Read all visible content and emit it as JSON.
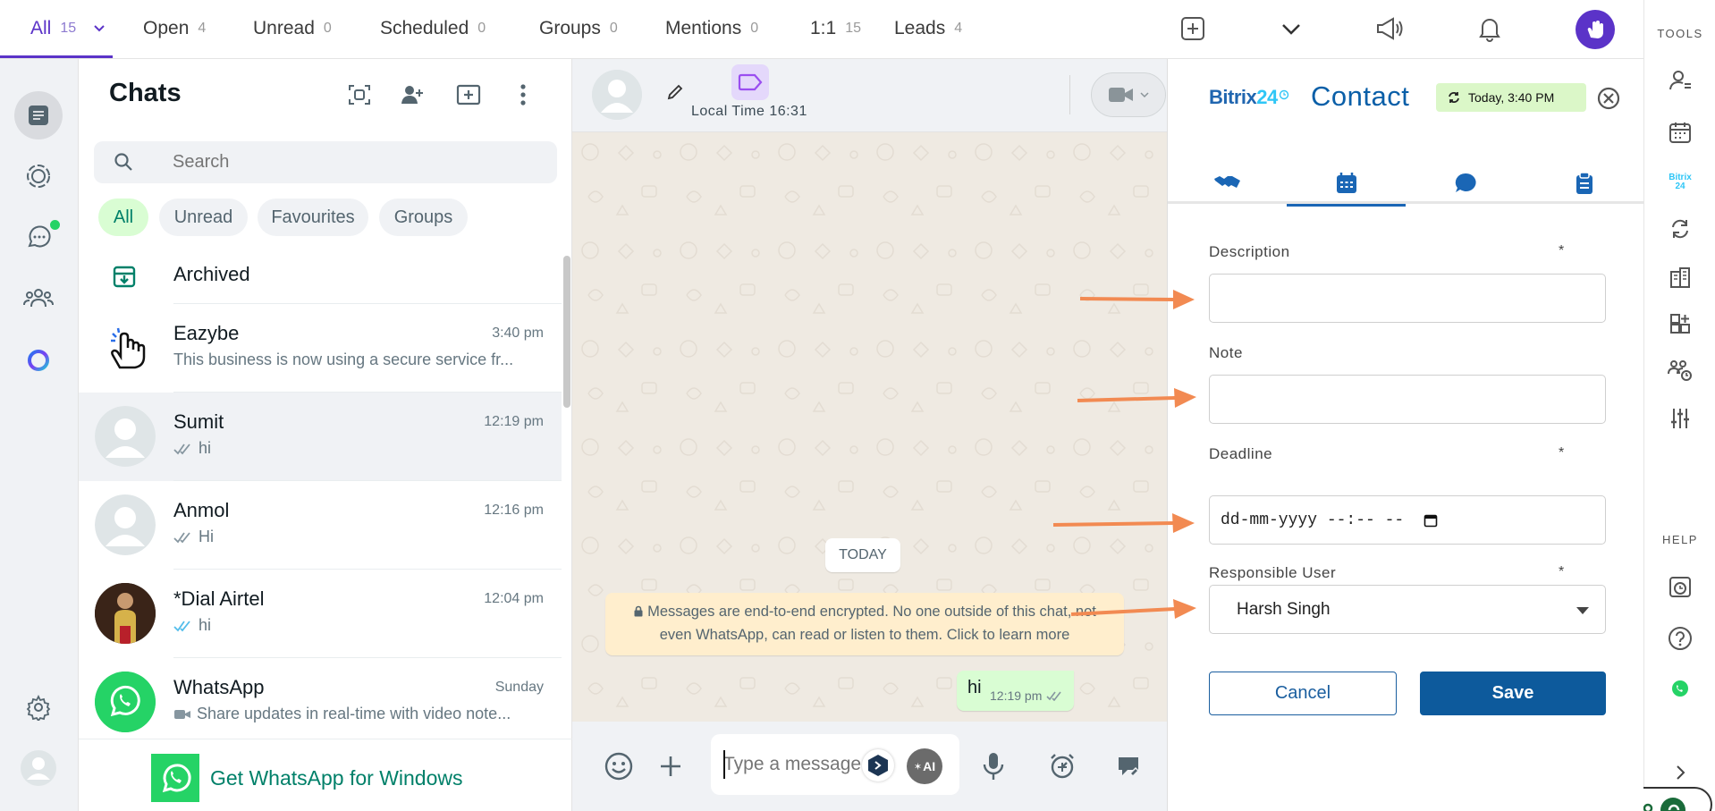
{
  "topbar": {
    "tabs": [
      {
        "label": "All",
        "count": "15"
      },
      {
        "label": "Open",
        "count": "4"
      },
      {
        "label": "Unread",
        "count": "0"
      },
      {
        "label": "Scheduled",
        "count": "0"
      },
      {
        "label": "Groups",
        "count": "0"
      },
      {
        "label": "Mentions",
        "count": "0"
      },
      {
        "label": "1:1",
        "count": "15"
      },
      {
        "label": "Leads",
        "count": "4"
      }
    ],
    "icons": [
      "add-square-icon",
      "chevron-down-icon",
      "megaphone-icon",
      "bell-icon",
      "user-avatar"
    ]
  },
  "tools": {
    "label": "TOOLS",
    "help_label": "HELP",
    "brand_mini": "Bitrix 24"
  },
  "chatlist": {
    "title": "Chats",
    "search_placeholder": "Search",
    "filters": [
      "All",
      "Unread",
      "Favourites",
      "Groups"
    ],
    "archived_label": "Archived",
    "chats": [
      {
        "name": "Eazybe",
        "time": "3:40 pm",
        "preview": "This business is now using a secure service fr..."
      },
      {
        "name": "Sumit",
        "time": "12:19 pm",
        "preview": "hi"
      },
      {
        "name": "Anmol",
        "time": "12:16 pm",
        "preview": "Hi"
      },
      {
        "name": "*Dial Airtel",
        "time": "12:04 pm",
        "preview": "hi"
      },
      {
        "name": "WhatsApp",
        "time": "Sunday",
        "preview": "Share updates in real-time with video note..."
      }
    ],
    "get_whatsapp": "Get WhatsApp for Windows"
  },
  "conversation": {
    "local_time": "Local Time 16:31",
    "today": "TODAY",
    "encryption_notice": "Messages are end-to-end encrypted. No one outside of this chat, not even WhatsApp, can read or listen to them. Click to learn more",
    "message_text": "hi",
    "message_time": "12:19 pm",
    "composer_placeholder": "Type a message",
    "ai_label": "AI"
  },
  "contact_panel": {
    "brand": "Bitrix",
    "brand_num": "24",
    "title": "Contact",
    "timestamp": "Today, 3:40 PM",
    "description_label": "Description",
    "note_label": "Note",
    "deadline_label": "Deadline",
    "deadline_placeholder": "dd-mm-yyyy --:-- --",
    "responsible_label": "Responsible User",
    "responsible_value": "Harsh Singh",
    "required_mark": "*",
    "cancel_label": "Cancel",
    "save_label": "Save"
  },
  "colors": {
    "accent": "#5b33c8",
    "whatsapp_green": "#25d366",
    "bitrix_blue": "#0d5a9c",
    "arrow": "#f28a52"
  }
}
